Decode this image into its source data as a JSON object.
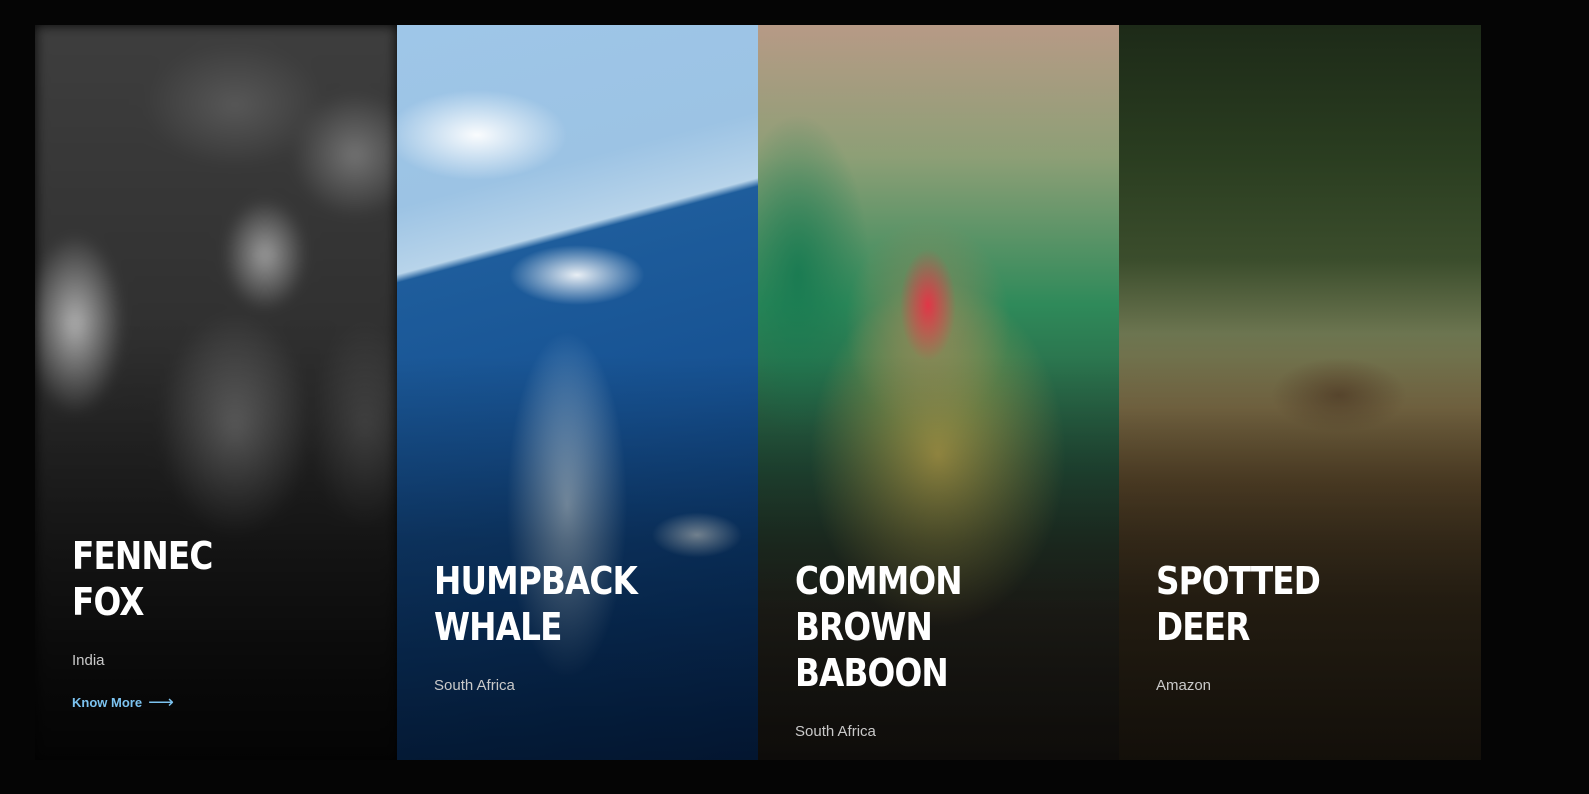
{
  "cards": [
    {
      "title": "FENNEC\nFOX",
      "location": "India",
      "link_label": "Know More",
      "link_arrow": "⟶",
      "active": true,
      "image": "fennec-fox-photo-blurred-grayscale"
    },
    {
      "title": "HUMPBACK\nWHALE",
      "location": "South Africa",
      "image": "humpback-whale-photo"
    },
    {
      "title": "COMMON BROWN\nBABOON",
      "location": "South Africa",
      "image": "mandrill-baboon-photo"
    },
    {
      "title": "SPOTTED\nDEER",
      "location": "Amazon",
      "image": "spotted-deer-photo"
    }
  ],
  "colors": {
    "background": "#050505",
    "link": "#7cc3f0",
    "title": "#ffffff",
    "location": "#c9c9c9"
  }
}
